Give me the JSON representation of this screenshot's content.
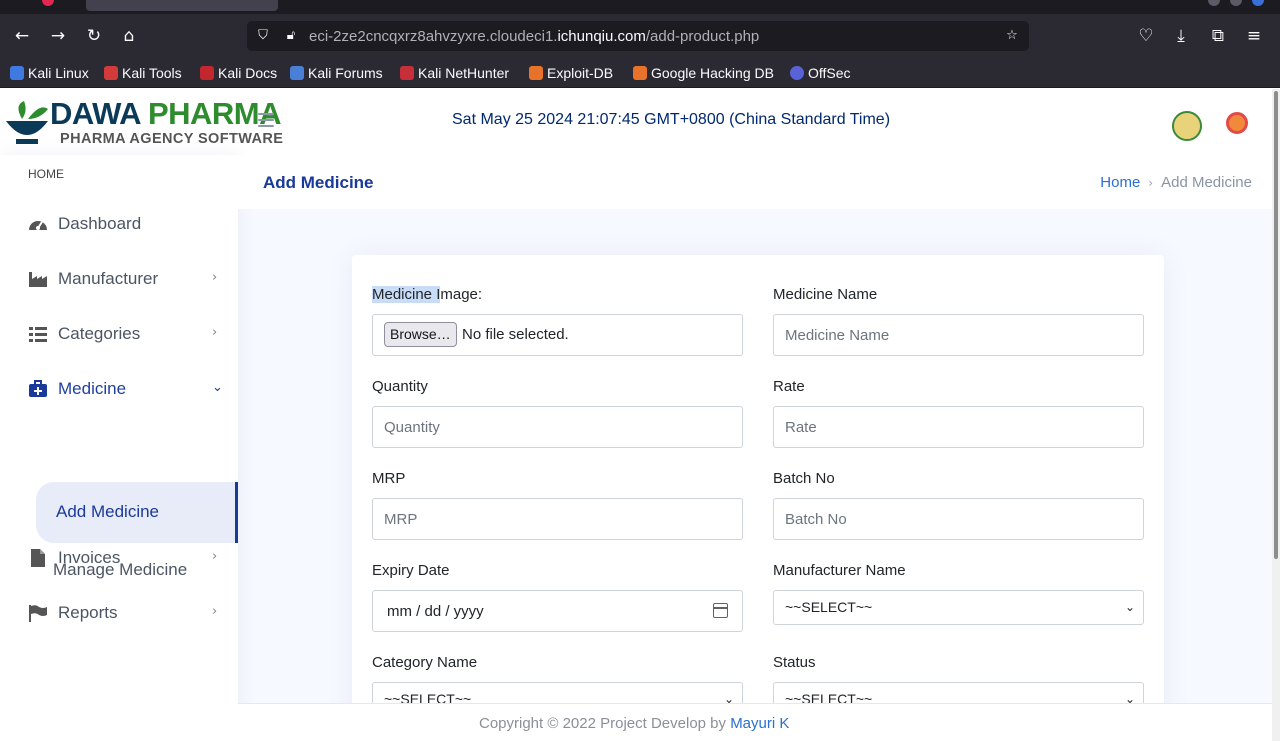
{
  "browser": {
    "url_prefix": "eci-2ze2cncqxrz8ahvzyxre.cloudeci1.",
    "url_domain": "ichunqiu.com",
    "url_path": "/add-product.php",
    "bookmarks": [
      "Kali Linux",
      "Kali Tools",
      "Kali Docs",
      "Kali Forums",
      "Kali NetHunter",
      "Exploit-DB",
      "Google Hacking DB",
      "OffSec"
    ]
  },
  "header": {
    "logo_main": "DAWA ",
    "logo_accent": "PHARMA",
    "logo_sub": "PHARMA AGENCY SOFTWARE",
    "datetime": "Sat May 25 2024 21:07:45 GMT+0800 (China Standard Time)"
  },
  "sidebar": {
    "heading": "HOME",
    "items": [
      {
        "label": "Dashboard"
      },
      {
        "label": "Manufacturer"
      },
      {
        "label": "Categories"
      },
      {
        "label": "Medicine"
      },
      {
        "label": "Invoices"
      },
      {
        "label": "Reports"
      }
    ],
    "sub_items": [
      "Add Medicine",
      "Manage Medicine"
    ]
  },
  "main": {
    "title": "Add Medicine",
    "breadcrumb_home": "Home",
    "breadcrumb_current": "Add Medicine"
  },
  "form": {
    "image_label_sel": "Medicine I",
    "image_label_rest": "mage:",
    "browse_label": "Browse…",
    "file_status": "No file selected.",
    "name_label": "Medicine Name",
    "name_placeholder": "Medicine Name",
    "quantity_label": "Quantity",
    "quantity_placeholder": "Quantity",
    "rate_label": "Rate",
    "rate_placeholder": "Rate",
    "mrp_label": "MRP",
    "mrp_placeholder": "MRP",
    "batch_label": "Batch No",
    "batch_placeholder": "Batch No",
    "expiry_label": "Expiry Date",
    "expiry_value": "mm / dd / yyyy",
    "manufacturer_label": "Manufacturer Name",
    "manufacturer_value": "~~SELECT~~",
    "category_label": "Category Name",
    "category_value": "~~SELECT~~",
    "status_label": "Status",
    "status_value": "~~SELECT~~"
  },
  "footer": {
    "text": "Copyright © 2022 Project Develop by ",
    "author": "Mayuri K"
  },
  "colors": {
    "accent": "#1a3a9a",
    "link": "#2a6fd6",
    "page_bg": "#f6f9ff"
  }
}
